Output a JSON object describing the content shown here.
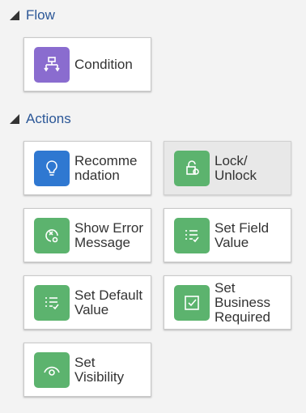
{
  "colors": {
    "section_title": "#2b5797",
    "flow_icon_bg": "#8a6ccf",
    "info_icon_bg": "#2f78d1",
    "action_icon_bg": "#5cb36e"
  },
  "sections": {
    "flow": {
      "title": "Flow"
    },
    "actions": {
      "title": "Actions"
    }
  },
  "cards": {
    "condition": {
      "label": "Condition",
      "icon": "flow-chart-icon"
    },
    "recommendation": {
      "label": "Recomme\nndation",
      "icon": "lightbulb-icon"
    },
    "lock_unlock": {
      "label": "Lock/\nUnlock",
      "icon": "lock-icon",
      "state": "disabled"
    },
    "show_error": {
      "label": "Show Error\nMessage",
      "icon": "error-icon"
    },
    "set_field_value": {
      "label": "Set Field\nValue",
      "icon": "checklist-icon"
    },
    "set_default_value": {
      "label": "Set Default\nValue",
      "icon": "checklist-icon"
    },
    "set_business_required": {
      "label": "Set\nBusiness\nRequired",
      "icon": "checkbox-icon"
    },
    "set_visibility": {
      "label": "Set\nVisibility",
      "icon": "eye-icon"
    }
  }
}
